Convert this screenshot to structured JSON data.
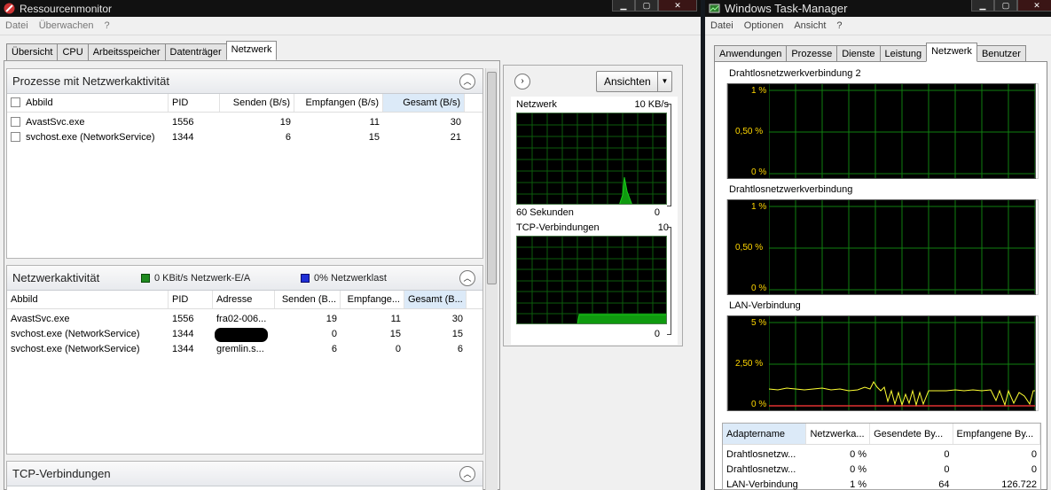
{
  "rm": {
    "title": "Ressourcenmonitor",
    "menu": [
      "Datei",
      "Überwachen",
      "?"
    ],
    "tabs": [
      "Übersicht",
      "CPU",
      "Arbeitsspeicher",
      "Datenträger",
      "Netzwerk"
    ],
    "proc_section": {
      "title": "Prozesse mit Netzwerkaktivität",
      "cols": [
        "Abbild",
        "PID",
        "Senden (B/s)",
        "Empfangen (B/s)",
        "Gesamt (B/s)"
      ],
      "rows": [
        [
          "AvastSvc.exe",
          "1556",
          "19",
          "11",
          "30"
        ],
        [
          "svchost.exe (NetworkService)",
          "1344",
          "6",
          "15",
          "21"
        ]
      ]
    },
    "net_section": {
      "title": "Netzwerkaktivität",
      "badge1": "0 KBit/s Netzwerk-E/A",
      "badge1_color": "#1f8a1f",
      "badge2": "0% Netzwerklast",
      "badge2_color": "#1f2fd6",
      "cols": [
        "Abbild",
        "PID",
        "Adresse",
        "Senden (B...",
        "Empfange...",
        "Gesamt (B..."
      ],
      "rows": [
        [
          "AvastSvc.exe",
          "1556",
          "fra02-006...",
          "19",
          "11",
          "30"
        ],
        [
          "svchost.exe (NetworkService)",
          "1344",
          "",
          "0",
          "15",
          "15"
        ],
        [
          "svchost.exe (NetworkService)",
          "1344",
          "gremlin.s...",
          "6",
          "0",
          "6"
        ]
      ]
    },
    "tcp_section": {
      "title": "TCP-Verbindungen"
    },
    "views_button": "Ansichten",
    "graph1": {
      "title": "Netzwerk",
      "max": "10 KB/s",
      "footer": "60 Sekunden",
      "min": "0"
    },
    "graph2": {
      "title": "TCP-Verbindungen",
      "max": "10",
      "min": "0"
    }
  },
  "tm": {
    "title": "Windows Task-Manager",
    "menu": [
      "Datei",
      "Optionen",
      "Ansicht",
      "?"
    ],
    "tabs": [
      "Anwendungen",
      "Prozesse",
      "Dienste",
      "Leistung",
      "Netzwerk",
      "Benutzer"
    ],
    "graphs": [
      {
        "title": "Drahtlosnetzwerkverbindung 2",
        "ticks": [
          "1 %",
          "0,50 %",
          "0 %"
        ]
      },
      {
        "title": "Drahtlosnetzwerkverbindung",
        "ticks": [
          "1 %",
          "0,50 %",
          "0 %"
        ]
      },
      {
        "title": "LAN-Verbindung",
        "ticks": [
          "5 %",
          "2,50 %",
          "0 %"
        ]
      }
    ],
    "table": {
      "cols": [
        "Adaptername",
        "Netzwerka...",
        "Gesendete By...",
        "Empfangene By..."
      ],
      "rows": [
        [
          "Drahtlosnetzw...",
          "0 %",
          "0",
          "0"
        ],
        [
          "Drahtlosnetzw...",
          "0 %",
          "0",
          "0"
        ],
        [
          "LAN-Verbindung",
          "1 %",
          "64",
          "126.722"
        ]
      ]
    }
  }
}
